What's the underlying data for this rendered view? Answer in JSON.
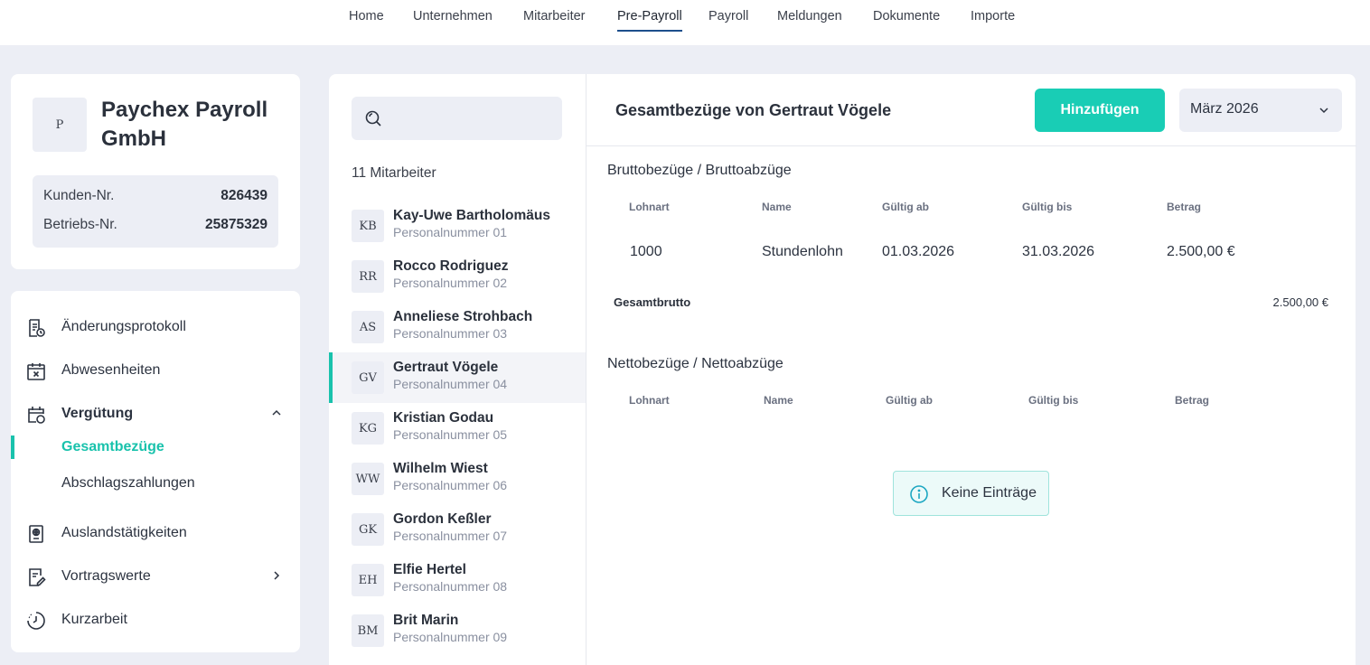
{
  "nav": [
    "Home",
    "Unternehmen",
    "Mitarbeiter",
    "Pre-Payroll",
    "Payroll",
    "Meldungen",
    "Dokumente",
    "Importe"
  ],
  "nav_active": "Pre-Payroll",
  "company": {
    "avatar": "P",
    "name": "Paychex Payroll GmbH",
    "customer_label": "Kunden-Nr.",
    "customer_no": "826439",
    "business_label": "Betriebs-Nr.",
    "business_no": "25875329"
  },
  "menu": {
    "protocol": "Änderungsprotokoll",
    "absences": "Abwesenheiten",
    "compensation": "Vergütung",
    "total_pay": "Gesamtbezüge",
    "advances": "Abschlagszahlungen",
    "abroad": "Auslandstätigkeiten",
    "carryover": "Vortragswerte",
    "short_time": "Kurzarbeit"
  },
  "search": {
    "placeholder": ""
  },
  "employee_count": "11 Mitarbeiter",
  "employees": [
    {
      "initials": "KB",
      "name": "Kay-Uwe Bartholomäus",
      "number": "Personalnummer 01"
    },
    {
      "initials": "RR",
      "name": "Rocco Rodriguez",
      "number": "Personalnummer 02"
    },
    {
      "initials": "AS",
      "name": "Anneliese Strohbach",
      "number": "Personalnummer 03"
    },
    {
      "initials": "GV",
      "name": "Gertraut Vögele",
      "number": "Personalnummer 04"
    },
    {
      "initials": "KG",
      "name": "Kristian Godau",
      "number": "Personalnummer 05"
    },
    {
      "initials": "WW",
      "name": "Wilhelm Wiest",
      "number": "Personalnummer 06"
    },
    {
      "initials": "GK",
      "name": "Gordon Keßler",
      "number": "Personalnummer 07"
    },
    {
      "initials": "EH",
      "name": "Elfie Hertel",
      "number": "Personalnummer 08"
    },
    {
      "initials": "BM",
      "name": "Brit Marin",
      "number": "Personalnummer 09"
    }
  ],
  "main": {
    "title": "Gesamtbezüge von Gertraut Vögele",
    "add_label": "Hinzufügen",
    "month": "März 2026",
    "gross_title": "Bruttobezüge / Bruttoabzüge",
    "columns": [
      "Lohnart",
      "Name",
      "Gültig ab",
      "Gültig bis",
      "Betrag"
    ],
    "gross_rows": [
      [
        "1000",
        "Stundenlohn",
        "01.03.2026",
        "31.03.2026",
        "2.500,00 €"
      ]
    ],
    "total_label": "Gesamtbrutto",
    "total_value": "2.500,00 €",
    "net_title": "Nettobezüge / Nettoabzüge",
    "empty_label": "Keine Einträge"
  },
  "colors": {
    "accent": "#19cdb5",
    "nav_underline": "#1d4f8c",
    "background": "#eceef5"
  }
}
